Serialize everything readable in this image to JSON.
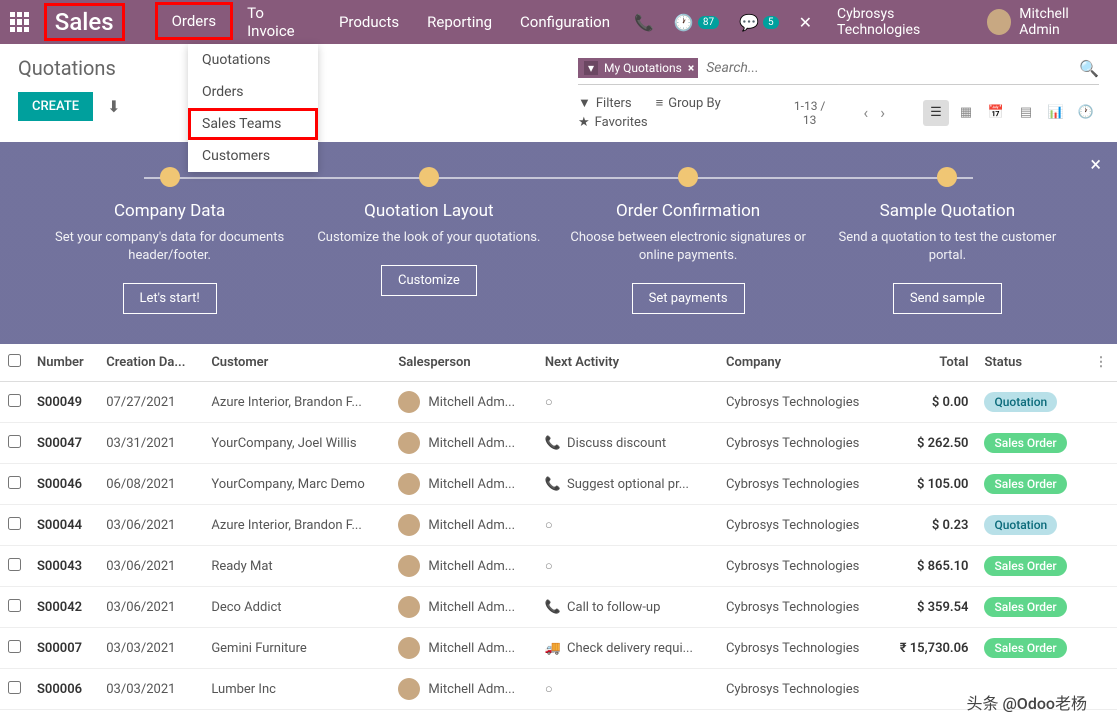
{
  "topbar": {
    "brand": "Sales",
    "nav": [
      "Orders",
      "To Invoice",
      "Products",
      "Reporting",
      "Configuration"
    ],
    "badge_clock": "87",
    "badge_chat": "5",
    "company": "Cybrosys Technologies",
    "user": "Mitchell Admin"
  },
  "dropdown": {
    "items": [
      "Quotations",
      "Orders",
      "Sales Teams",
      "Customers"
    ]
  },
  "cp": {
    "title": "Quotations",
    "create": "CREATE",
    "facet": "My Quotations",
    "search_placeholder": "Search...",
    "filters": "Filters",
    "groupby": "Group By",
    "favorites": "Favorites",
    "pager_top": "1-13 /",
    "pager_bot": "13"
  },
  "banner": {
    "steps": [
      {
        "title": "Company Data",
        "desc": "Set your company's data for documents header/footer.",
        "btn": "Let's start!"
      },
      {
        "title": "Quotation Layout",
        "desc": "Customize the look of your quotations.",
        "btn": "Customize"
      },
      {
        "title": "Order Confirmation",
        "desc": "Choose between electronic signatures or online payments.",
        "btn": "Set payments"
      },
      {
        "title": "Sample Quotation",
        "desc": "Send a quotation to test the customer portal.",
        "btn": "Send sample"
      }
    ]
  },
  "cols": [
    "Number",
    "Creation Da...",
    "Customer",
    "Salesperson",
    "Next Activity",
    "Company",
    "Total",
    "Status"
  ],
  "rows": [
    {
      "number": "S00049",
      "date": "07/27/2021",
      "customer": "Azure Interior, Brandon F...",
      "sp": "Mitchell Adm...",
      "act_icon": "none",
      "activity": "",
      "company": "Cybrosys Technologies",
      "total": "$ 0.00",
      "status": "Quotation"
    },
    {
      "number": "S00047",
      "date": "03/31/2021",
      "customer": "YourCompany, Joel Willis",
      "sp": "Mitchell Adm...",
      "act_icon": "phone",
      "activity": "Discuss discount",
      "company": "Cybrosys Technologies",
      "total": "$ 262.50",
      "status": "Sales Order"
    },
    {
      "number": "S00046",
      "date": "06/08/2021",
      "customer": "YourCompany, Marc Demo",
      "sp": "Mitchell Adm...",
      "act_icon": "phone",
      "activity": "Suggest optional pr...",
      "company": "Cybrosys Technologies",
      "total": "$ 105.00",
      "status": "Sales Order"
    },
    {
      "number": "S00044",
      "date": "03/06/2021",
      "customer": "Azure Interior, Brandon F...",
      "sp": "Mitchell Adm...",
      "act_icon": "none",
      "activity": "",
      "company": "Cybrosys Technologies",
      "total": "$ 0.23",
      "status": "Quotation"
    },
    {
      "number": "S00043",
      "date": "03/06/2021",
      "customer": "Ready Mat",
      "sp": "Mitchell Adm...",
      "act_icon": "none",
      "activity": "",
      "company": "Cybrosys Technologies",
      "total": "$ 865.10",
      "status": "Sales Order"
    },
    {
      "number": "S00042",
      "date": "03/06/2021",
      "customer": "Deco Addict",
      "sp": "Mitchell Adm...",
      "act_icon": "phone",
      "activity": "Call to follow-up",
      "company": "Cybrosys Technologies",
      "total": "$ 359.54",
      "status": "Sales Order"
    },
    {
      "number": "S00007",
      "date": "03/03/2021",
      "customer": "Gemini Furniture",
      "sp": "Mitchell Adm...",
      "act_icon": "truck",
      "activity": "Check delivery requi...",
      "company": "Cybrosys Technologies",
      "total": "₹ 15,730.06",
      "status": "Sales Order"
    },
    {
      "number": "S00006",
      "date": "03/03/2021",
      "customer": "Lumber Inc",
      "sp": "Mitchell Adm...",
      "act_icon": "none",
      "activity": "",
      "company": "Cybrosys Technologies",
      "total": "",
      "status": ""
    }
  ],
  "watermark": "头条 @Odoo老杨"
}
